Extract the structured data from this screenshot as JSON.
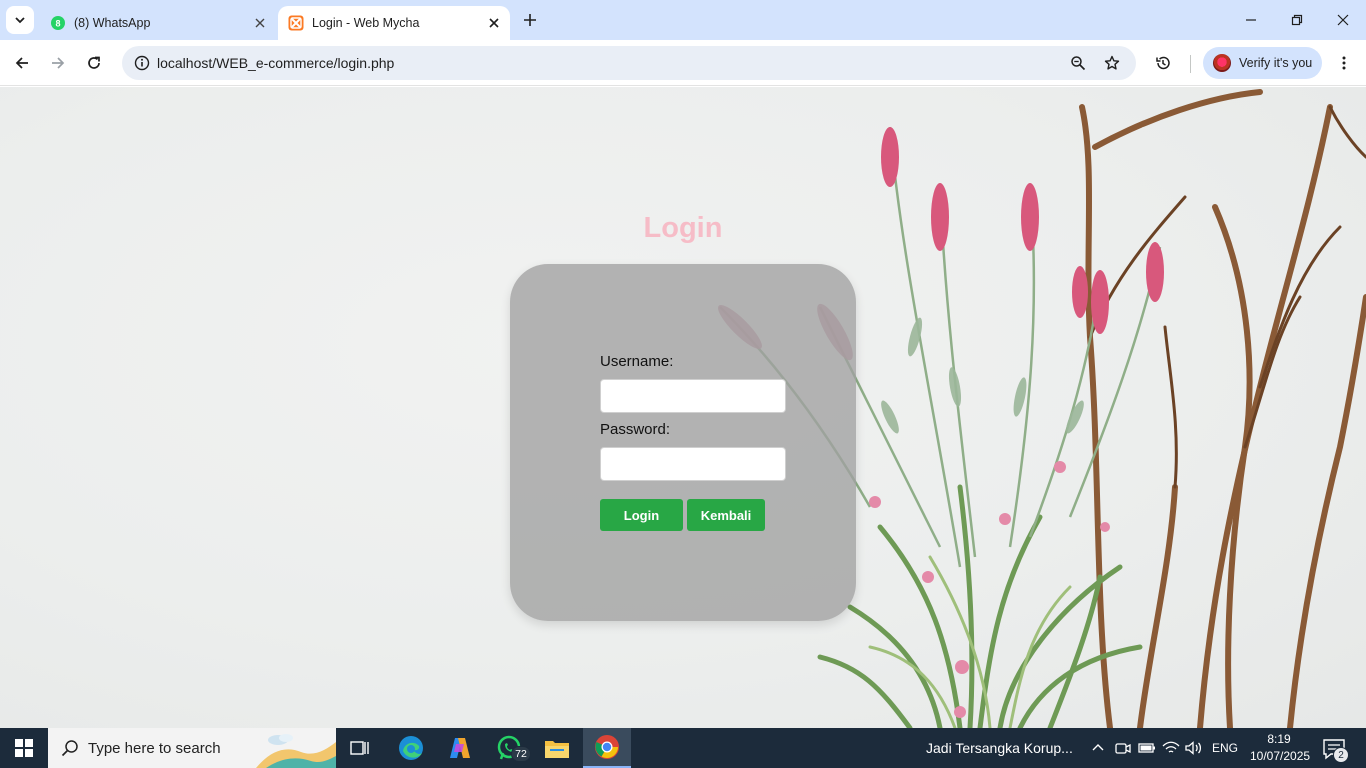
{
  "browser": {
    "tabs": [
      {
        "title": "(8) WhatsApp",
        "favicon": "whatsapp-icon",
        "active": false
      },
      {
        "title": "Login - Web Mycha",
        "favicon": "xampp-icon",
        "active": true
      }
    ],
    "url": "localhost/WEB_e-commerce/login.php",
    "profile_label": "Verify it's you"
  },
  "page": {
    "title": "Login",
    "form": {
      "username_label": "Username:",
      "username_value": "",
      "password_label": "Password:",
      "password_value": "",
      "login_button": "Login",
      "back_button": "Kembali"
    },
    "colors": {
      "title": "#f6bcc7",
      "button": "#28a745",
      "card": "#a0a0a0"
    }
  },
  "taskbar": {
    "search_placeholder": "Type here to search",
    "apps": [
      "task-view-icon",
      "edge-icon",
      "copilot-icon",
      "whatsapp-icon",
      "file-explorer-icon",
      "chrome-icon"
    ],
    "whatsapp_badge": "72",
    "news_text": "Jadi Tersangka Korup...",
    "language": "ENG",
    "time": "8:19",
    "date": "10/07/2025",
    "notification_count": "2"
  }
}
